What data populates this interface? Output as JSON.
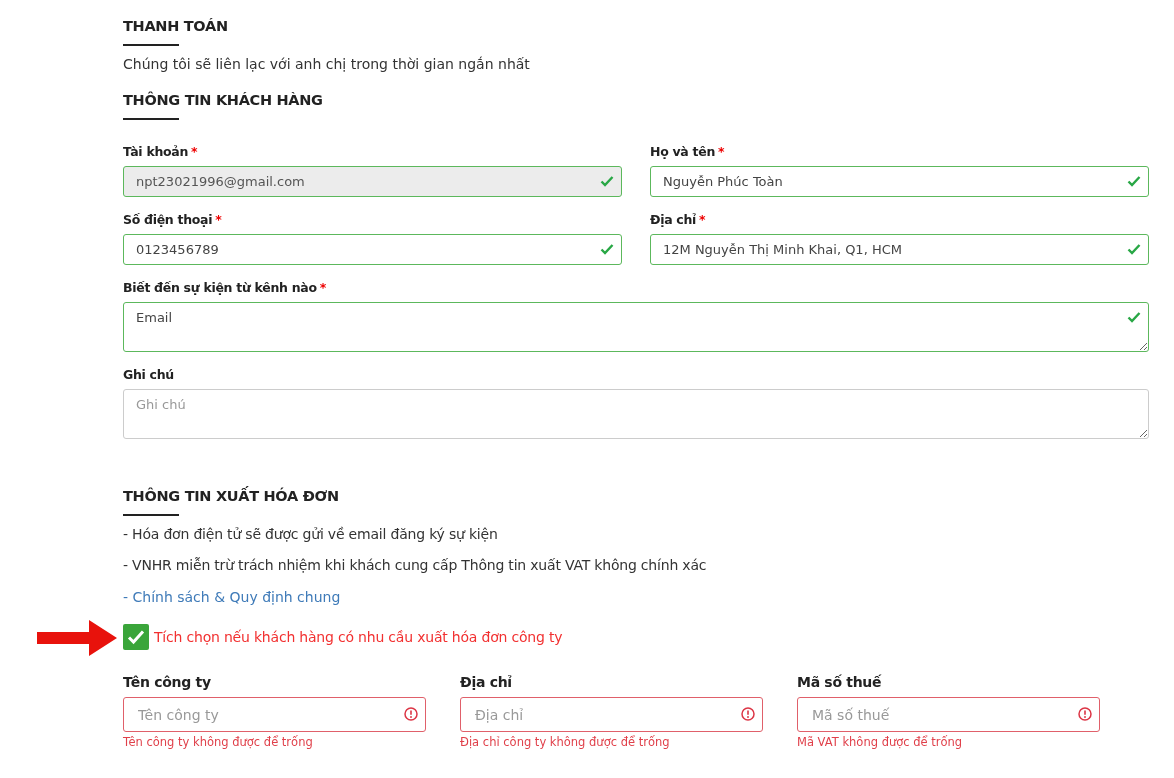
{
  "payment": {
    "title": "THANH TOÁN",
    "subtitle": "Chúng tôi sẽ liên lạc với anh chị trong thời gian ngắn nhất"
  },
  "customer": {
    "title": "THÔNG TIN KHÁCH HÀNG",
    "fields": [
      {
        "kind": "input",
        "label": "Tài khoản",
        "asterisk": "*",
        "value": "npt23021996@gmail.com",
        "valid": true,
        "disabled": true
      },
      {
        "kind": "input",
        "label": "Họ và tên",
        "asterisk": "*",
        "value": "Nguyễn Phúc Toàn",
        "valid": true,
        "disabled": false
      },
      {
        "kind": "input",
        "label": "Số điện thoại",
        "asterisk": "*",
        "value": "0123456789",
        "valid": true,
        "disabled": false
      },
      {
        "kind": "input",
        "label": "Địa chỉ",
        "asterisk": "*",
        "value": "12M Nguyễn Thị Minh Khai, Q1, HCM",
        "valid": true,
        "disabled": false
      },
      {
        "kind": "textarea",
        "label": "Biết đến sự kiện từ kênh nào",
        "asterisk": "*",
        "value": "Email",
        "valid": true,
        "disabled": false
      },
      {
        "kind": "textarea",
        "label": "Ghi chú",
        "placeholder": "Ghi chú",
        "valid": false,
        "disabled": false
      }
    ]
  },
  "invoice": {
    "title": "THÔNG TIN XUẤT HÓA ĐƠN",
    "notes": [
      "- Hóa đơn điện tử sẽ được gửi về email đăng ký sự kiện",
      "- VNHR miễn trừ trách nhiệm khi khách cung cấp Thông tin xuất VAT không chính xác"
    ],
    "link": "- Chính sách & Quy định chung",
    "checkbox": {
      "label": "Tích chọn nếu khách hàng có nhu cầu xuất hóa đơn công ty",
      "checked": true
    },
    "fields": [
      {
        "label": "Tên công ty",
        "placeholder": "Tên công ty",
        "invalid": true,
        "error": "Tên công ty không được để trống"
      },
      {
        "label": "Địa chỉ",
        "placeholder": "Địa chỉ",
        "invalid": true,
        "error": "Địa chỉ công ty không được để trống"
      },
      {
        "label": "Mã số thuế",
        "placeholder": "Mã số thuế",
        "invalid": true,
        "error": "Mã VAT không được để trống"
      }
    ]
  }
}
